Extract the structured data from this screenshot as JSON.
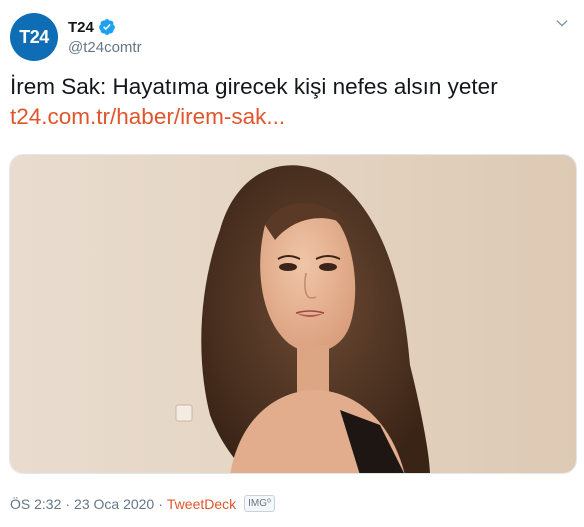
{
  "author": {
    "avatar_text": "T24",
    "display_name": "T24",
    "handle": "@t24comtr",
    "verified": true,
    "avatar_color": "#0f6db5",
    "verified_color": "#1da1f2"
  },
  "tweet": {
    "text": "İrem Sak: Hayatıma girecek kişi nefes alsın yeter",
    "link_text": "t24.com.tr/haber/irem-sak...",
    "link_color": "#e0552b",
    "media_alt": "photo"
  },
  "footer": {
    "time": "ÖS 2:32",
    "separator": "·",
    "date": "23 Oca 2020",
    "source": "TweetDeck",
    "badge": "IMG⁰"
  },
  "icons": {
    "caret": "chevron-down-icon",
    "verified": "verified-badge-icon"
  }
}
